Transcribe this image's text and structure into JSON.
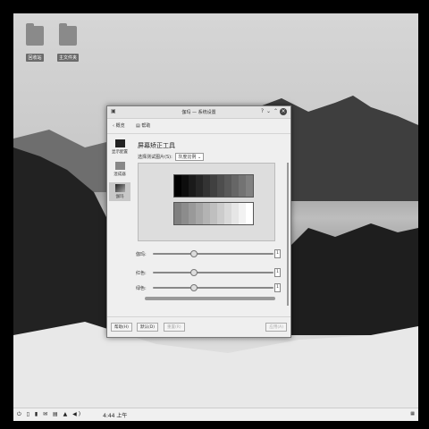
{
  "desktop": {
    "icons": [
      {
        "label": "回收站"
      },
      {
        "label": "主文件夹"
      }
    ]
  },
  "window": {
    "title": "伽玛 — 系统设置",
    "titlebar_help": "?",
    "titlebar_minimize": "⌄",
    "titlebar_maximize": "⌃",
    "titlebar_close": "×",
    "toolbar": {
      "back_label": "概览",
      "help_label": "帮助"
    },
    "sidebar": [
      {
        "label": "显示配置"
      },
      {
        "label": "混成器"
      },
      {
        "label": "伽玛"
      }
    ],
    "heading": "屏幕矫正工具",
    "select_label": "选择测试图片(S):",
    "select_value": "灰度比例",
    "sliders": [
      {
        "label": "伽玛:",
        "value": "1",
        "level": 0.33
      },
      {
        "label": "红色:",
        "value": "1",
        "level": 0.33
      },
      {
        "label": "绿色:",
        "value": "1",
        "level": 0.33
      }
    ],
    "footer": {
      "help_button": "帮助(H)",
      "defaults_button": "默认(D)",
      "reset_button": "重置(R)",
      "apply_button": "应用(A)"
    }
  },
  "taskbar": {
    "clock": "4:44 上午",
    "tray": "⏻ ▯ ▮ ✉ ▤ ▲ ◀)"
  },
  "colors": {
    "window_bg": "#efefef",
    "taskbar_bg": "#f0f0f0"
  }
}
